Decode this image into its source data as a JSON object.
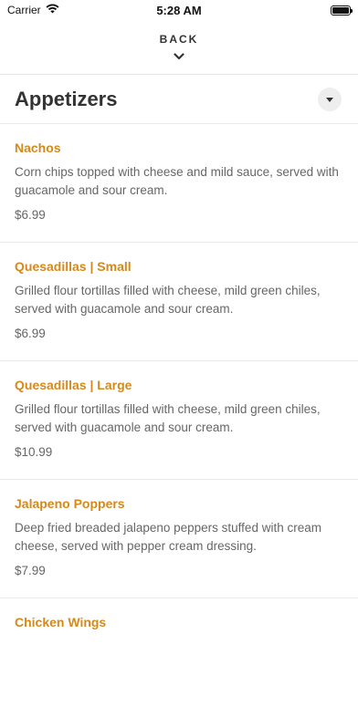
{
  "status_bar": {
    "carrier": "Carrier",
    "time": "5:28 AM"
  },
  "nav": {
    "back_label": "BACK"
  },
  "section": {
    "title": "Appetizers"
  },
  "items": [
    {
      "name": "Nachos",
      "description": "Corn chips topped with cheese and mild sauce, served with guacamole and sour cream.",
      "price": "$6.99"
    },
    {
      "name": "Quesadillas | Small",
      "description": "Grilled flour tortillas filled with cheese, mild green chiles, served with guacamole and sour cream.",
      "price": "$6.99"
    },
    {
      "name": "Quesadillas | Large",
      "description": "Grilled flour tortillas filled with cheese, mild green chiles, served with guacamole and sour cream.",
      "price": "$10.99"
    },
    {
      "name": "Jalapeno Poppers",
      "description": "Deep fried breaded jalapeno peppers stuffed with cream cheese, served with pepper cream dressing.",
      "price": "$7.99"
    },
    {
      "name": "Chicken Wings",
      "description": "",
      "price": ""
    }
  ],
  "colors": {
    "accent": "#d4891a",
    "text_muted": "#666666"
  }
}
